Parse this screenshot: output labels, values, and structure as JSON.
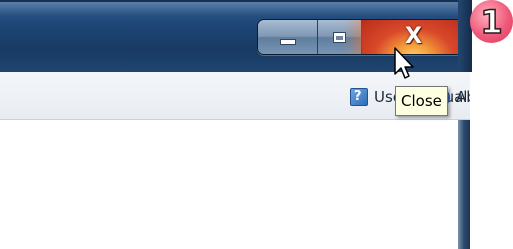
{
  "window": {
    "controls": {
      "minimize_icon": "minimize-icon",
      "maximize_icon": "maximize-icon",
      "close_glyph": "X"
    }
  },
  "toolbar": {
    "items": [
      {
        "label": "User Manual",
        "icon": "help-book-icon"
      },
      {
        "label": "About",
        "icon": "info-icon"
      }
    ]
  },
  "tooltip": {
    "text": "Close"
  },
  "badge": {
    "number": "1",
    "color": "#e8476a"
  },
  "colors": {
    "titlebar": "#1d4575",
    "close_button": "#d8482a",
    "tooltip_bg": "#ffffe1"
  }
}
